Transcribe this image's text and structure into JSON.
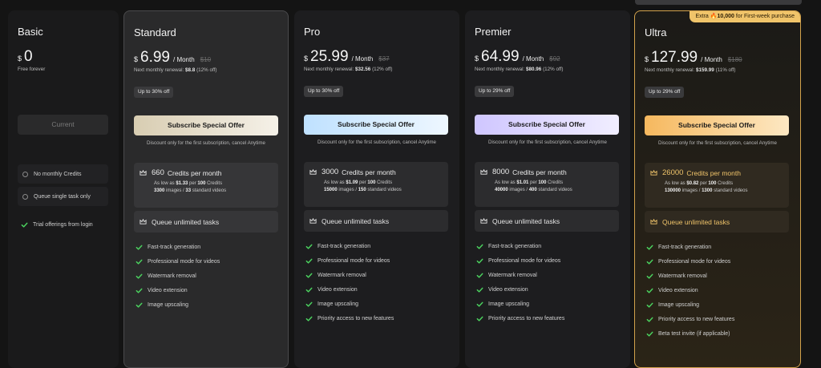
{
  "colors": {
    "check": "#4bd35f",
    "ultra_accent": "#f0c46a",
    "page_bg": "#141414"
  },
  "basic": {
    "name": "Basic",
    "currency": "$",
    "price": "0",
    "note": "Free forever",
    "button": "Current",
    "options": [
      "No monthly Credits",
      "Queue single task only"
    ],
    "check_item": "Trial offerings from login"
  },
  "standard": {
    "name": "Standard",
    "currency": "$",
    "price": "6.99",
    "per": "/ Month",
    "old": "$10",
    "renew_prefix": "Next monthly renewal:",
    "renew_value": "$8.8",
    "renew_suffix": "(12% off)",
    "badge": "Up to 30% off",
    "button": "Subscribe Special Offer",
    "discount_note": "Discount only for the first subscription, cancel Anytime",
    "credits": "660",
    "credits_label": "Credits per month",
    "low_a": "As low as",
    "low_price": "$1.33",
    "low_b": "per",
    "low_n": "100",
    "low_c": "Credits",
    "images": "3300",
    "images_label": "images /",
    "videos": "33",
    "videos_label": "standard videos",
    "queue": "Queue unlimited tasks",
    "features": [
      "Fast-track generation",
      "Professional mode for videos",
      "Watermark removal",
      "Video extension",
      "Image upscaling"
    ]
  },
  "pro": {
    "name": "Pro",
    "currency": "$",
    "price": "25.99",
    "per": "/ Month",
    "old": "$37",
    "renew_prefix": "Next monthly renewal:",
    "renew_value": "$32.56",
    "renew_suffix": "(12% off)",
    "badge": "Up to 30% off",
    "button": "Subscribe Special Offer",
    "discount_note": "Discount only for the first subscription, cancel Anytime",
    "credits": "3000",
    "credits_label": "Credits per month",
    "low_a": "As low as",
    "low_price": "$1.09",
    "low_b": "per",
    "low_n": "100",
    "low_c": "Credits",
    "images": "15000",
    "images_label": "images /",
    "videos": "150",
    "videos_label": "standard videos",
    "queue": "Queue unlimited tasks",
    "features": [
      "Fast-track generation",
      "Professional mode for videos",
      "Watermark removal",
      "Video extension",
      "Image upscaling",
      "Priority access to new features"
    ]
  },
  "premier": {
    "name": "Premier",
    "currency": "$",
    "price": "64.99",
    "per": "/ Month",
    "old": "$92",
    "renew_prefix": "Next monthly renewal:",
    "renew_value": "$80.96",
    "renew_suffix": "(12% off)",
    "badge": "Up to 29% off",
    "button": "Subscribe Special Offer",
    "discount_note": "Discount only for the first subscription, cancel Anytime",
    "credits": "8000",
    "credits_label": "Credits per month",
    "low_a": "As low as",
    "low_price": "$1.01",
    "low_b": "per",
    "low_n": "100",
    "low_c": "Credits",
    "images": "40000",
    "images_label": "images /",
    "videos": "400",
    "videos_label": "standard videos",
    "queue": "Queue unlimited tasks",
    "features": [
      "Fast-track generation",
      "Professional mode for videos",
      "Watermark removal",
      "Video extension",
      "Image upscaling",
      "Priority access to new features"
    ]
  },
  "ultra": {
    "name": "Ultra",
    "currency": "$",
    "price": "127.99",
    "per": "/ Month",
    "old": "$180",
    "ribbon_a": "Extra",
    "ribbon_b": "10,000",
    "ribbon_c": "for First-week purchase",
    "renew_prefix": "Next monthly renewal:",
    "renew_value": "$159.99",
    "renew_suffix": "(11% off)",
    "badge": "Up to 29% off",
    "button": "Subscribe Special Offer",
    "discount_note": "Discount only for the first subscription, cancel Anytime",
    "credits": "26000",
    "credits_label": "Credits per month",
    "low_a": "As low as",
    "low_price": "$0.82",
    "low_b": "per",
    "low_n": "100",
    "low_c": "Credits",
    "images": "130000",
    "images_label": "images /",
    "videos": "1300",
    "videos_label": "standard videos",
    "queue": "Queue unlimited tasks",
    "features": [
      "Fast-track generation",
      "Professional mode for videos",
      "Watermark removal",
      "Video extension",
      "Image upscaling",
      "Priority access to new features",
      "Beta test invite (if applicable)"
    ]
  }
}
